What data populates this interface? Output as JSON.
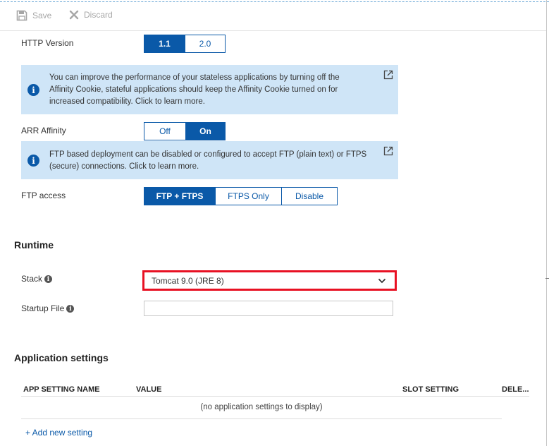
{
  "toolbar": {
    "save_label": "Save",
    "discard_label": "Discard"
  },
  "http_version": {
    "label": "HTTP Version",
    "options": [
      "1.1",
      "2.0"
    ],
    "selected": "1.1"
  },
  "affinity_info": {
    "text": "You can improve the performance of your stateless applications by turning off the Affinity Cookie, stateful applications should keep the Affinity Cookie turned on for increased compatibility. Click to learn more.",
    "icon": "info-icon"
  },
  "arr_affinity": {
    "label": "ARR Affinity",
    "options": [
      "Off",
      "On"
    ],
    "selected": "On"
  },
  "ftp_info": {
    "text": "FTP based deployment can be disabled or configured to accept FTP (plain text) or FTPS (secure) connections. Click to learn more.",
    "icon": "info-icon"
  },
  "ftp_access": {
    "label": "FTP access",
    "options": [
      "FTP + FTPS",
      "FTPS Only",
      "Disable"
    ],
    "selected": "FTP + FTPS"
  },
  "runtime": {
    "heading": "Runtime",
    "stack_label": "Stack",
    "stack_value": "Tomcat 9.0 (JRE 8)",
    "startup_file_label": "Startup File",
    "startup_file_value": ""
  },
  "app_settings": {
    "heading": "Application settings",
    "columns": [
      "APP SETTING NAME",
      "VALUE",
      "SLOT SETTING",
      "DELE..."
    ],
    "empty_text": "(no application settings to display)",
    "add_link": "+ Add new setting"
  },
  "colors": {
    "accent": "#0a59a8",
    "info_background": "#cfe5f7",
    "highlight_border": "#e81123",
    "disabled_text": "#a6a6a6"
  }
}
